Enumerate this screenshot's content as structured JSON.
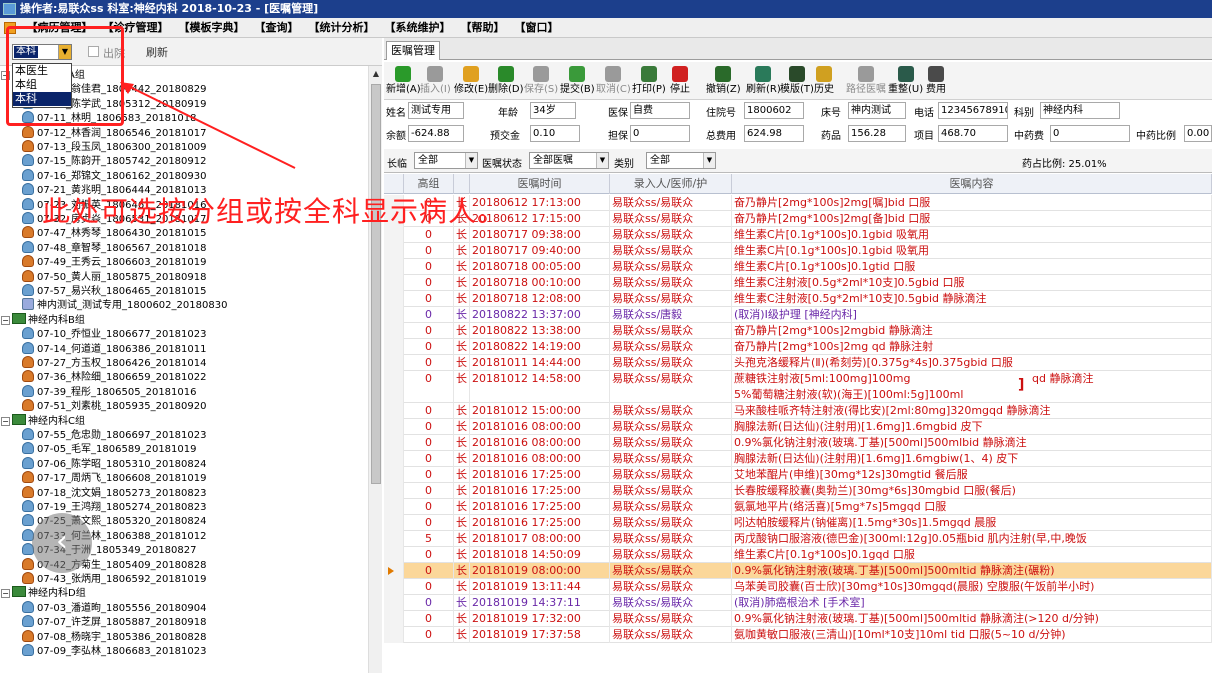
{
  "titlebar": {
    "text": "操作者:易联众ss  科室:神经内科  2018-10-23 - [医嘱管理]"
  },
  "menu": [
    "【病历管理】",
    "【诊疗管理】",
    "【模板字典】",
    "【查询】",
    "【统计分析】",
    "【系统维护】",
    "【帮助】",
    "【窗口】"
  ],
  "left": {
    "combo_value": "本科",
    "checkbox_label": "出院",
    "refresh_label": "刷新",
    "dropdown_options": [
      "本医生",
      "本组",
      "本科"
    ],
    "tree": [
      {
        "kind": "group",
        "label": "神经内科A组"
      },
      {
        "kind": "male",
        "label": "07-01_翁佳君_1805442_20180829"
      },
      {
        "kind": "male",
        "label": "07-02_陈学武_1805312_20180919"
      },
      {
        "kind": "male",
        "label": "07-11_林明_1806583_20181018"
      },
      {
        "kind": "female",
        "label": "07-12_林香润_1806546_20181017"
      },
      {
        "kind": "female",
        "label": "07-13_段玉凤_1806300_20181009"
      },
      {
        "kind": "male",
        "label": "07-15_陈韵开_1805742_20180912"
      },
      {
        "kind": "male",
        "label": "07-16_郑锦文_1806162_20180930"
      },
      {
        "kind": "male",
        "label": "07-21_黄兆明_1806444_20181013"
      },
      {
        "kind": "male",
        "label": "07-23_刘振英_1806461_20181016"
      },
      {
        "kind": "male",
        "label": "07-32_房贞焱_1806531_20181017"
      },
      {
        "kind": "female",
        "label": "07-47_林秀琴_1806430_20181015"
      },
      {
        "kind": "male",
        "label": "07-48_章智琴_1806567_20181018"
      },
      {
        "kind": "female",
        "label": "07-49_王秀云_1806603_20181019"
      },
      {
        "kind": "female",
        "label": "07-50_黄人丽_1805875_20180918"
      },
      {
        "kind": "male",
        "label": "07-57_易兴秋_1806465_20181015"
      },
      {
        "kind": "test",
        "label": "神内测试_测试专用_1800602_20180830"
      },
      {
        "kind": "group",
        "label": "神经内科B组"
      },
      {
        "kind": "male",
        "label": "07-10_乔恒业_1806677_20181023"
      },
      {
        "kind": "male",
        "label": "07-14_何道道_1806386_20181011"
      },
      {
        "kind": "female",
        "label": "07-27_方玉权_1806426_20181014"
      },
      {
        "kind": "female",
        "label": "07-36_林险细_1806659_20181022"
      },
      {
        "kind": "male",
        "label": "07-39_程彤_1806505_20181016"
      },
      {
        "kind": "female",
        "label": "07-51_刘素桃_1805935_20180920"
      },
      {
        "kind": "group",
        "label": "神经内科C组"
      },
      {
        "kind": "male",
        "label": "07-55_危忠勋_1806697_20181023"
      },
      {
        "kind": "male",
        "label": "07-05_毛军_1806589_20181019"
      },
      {
        "kind": "male",
        "label": "07-06_陈学昭_1805310_20180824"
      },
      {
        "kind": "female",
        "label": "07-17_周炳飞_1806608_20181019"
      },
      {
        "kind": "female",
        "label": "07-18_沈文娟_1805273_20180823"
      },
      {
        "kind": "male",
        "label": "07-19_王鸿翔_1805274_20180823"
      },
      {
        "kind": "male",
        "label": "07-25_萧文熙_1805320_20180824"
      },
      {
        "kind": "male",
        "label": "07-33_何兰林_1806388_20181012"
      },
      {
        "kind": "male",
        "label": "07-34_于洲_1805349_20180827"
      },
      {
        "kind": "female",
        "label": "07-42_方菊生_1805409_20180828"
      },
      {
        "kind": "female",
        "label": "07-43_张炳用_1806592_20181019"
      },
      {
        "kind": "group",
        "label": "神经内科D组"
      },
      {
        "kind": "male",
        "label": "07-03_潘道昫_1805556_20180904"
      },
      {
        "kind": "male",
        "label": "07-07_许芝屏_1805887_20180918"
      },
      {
        "kind": "female",
        "label": "07-08_杨晓宇_1805386_20180828"
      },
      {
        "kind": "male",
        "label": "07-09_李弘林_1806683_20181023"
      }
    ]
  },
  "annotation": "此处可选按分组或按全科显示病人。",
  "right": {
    "tab_label": "医嘱管理",
    "toolbar": [
      {
        "label": "新增(A)",
        "icon": "add-icon",
        "color": "#2a9a2a",
        "enabled": true
      },
      {
        "label": "插入(I)",
        "icon": "insert-icon",
        "color": "#9a9a9a",
        "enabled": false
      },
      {
        "label": "修改(E)",
        "icon": "edit-icon",
        "color": "#e0a020",
        "enabled": true
      },
      {
        "label": "删除(D)",
        "icon": "delete-icon",
        "color": "#2a8a2a",
        "enabled": true
      },
      {
        "label": "保存(S)",
        "icon": "save-icon",
        "color": "#9a9a9a",
        "enabled": false
      },
      {
        "label": "提交(B)",
        "icon": "submit-icon",
        "color": "#3a9a3a",
        "enabled": true
      },
      {
        "label": "取消(C)",
        "icon": "undo-icon",
        "color": "#9a9a9a",
        "enabled": false
      },
      {
        "label": "打印(P)",
        "icon": "print-icon",
        "color": "#3a7a3a",
        "enabled": true
      },
      {
        "label": "停止",
        "icon": "stop-icon",
        "color": "#d02020",
        "enabled": true
      },
      {
        "label": "撤销(Z)",
        "icon": "revoke-icon",
        "color": "#2a6a2a",
        "enabled": true
      },
      {
        "label": "刷新(R)",
        "icon": "refresh-icon",
        "color": "#2a7a5a",
        "enabled": true
      },
      {
        "label": "模版(T)",
        "icon": "template-icon",
        "color": "#2a4a2a",
        "enabled": true
      },
      {
        "label": "历史",
        "icon": "history-icon",
        "color": "#d0a020",
        "enabled": true
      },
      {
        "label": "路径医嘱",
        "icon": "path-icon",
        "color": "#9a9a9a",
        "enabled": false
      },
      {
        "label": "重整(U)",
        "icon": "reorg-icon",
        "color": "#2a5a4a",
        "enabled": true
      },
      {
        "label": "费用",
        "icon": "fee-icon",
        "color": "#4a4a4a",
        "enabled": true
      }
    ],
    "patient": {
      "name_label": "姓名",
      "name": "测试专用",
      "age_label": "年龄",
      "age": "34岁",
      "ins_label": "医保",
      "ins": "自费",
      "admit_label": "住院号",
      "admit": "1800602",
      "bed_label": "床号",
      "bed": "神内测试",
      "phone_label": "电话",
      "phone": "12345678910",
      "dept_label": "科别",
      "dept": "神经内科",
      "balance_label": "余额",
      "balance": "-624.88",
      "deposit_label": "预交金",
      "deposit": "0.10",
      "guarantee_label": "担保",
      "guarantee": "0",
      "total_label": "总费用",
      "total": "624.98",
      "drug_label": "药品",
      "drug": "156.28",
      "item_label": "项目",
      "item": "468.70",
      "tcm_label": "中药费",
      "tcm": "0",
      "tcm_ratio_label": "中药比例",
      "tcm_ratio": "0.00"
    },
    "filter": {
      "term_label": "长临",
      "term_value": "全部",
      "status_label": "医嘱状态",
      "status_value": "全部医嘱",
      "type_label": "类别",
      "type_value": "全部",
      "ratio": "药占比例: 25.01%"
    },
    "columns": [
      "",
      "高组",
      "",
      "医嘱时间",
      "录入人/医师/护",
      "医嘱内容"
    ],
    "rows": [
      {
        "n": "0",
        "t": "长",
        "time": "20180612 17:13:00",
        "who": "易联众ss/易联众",
        "content": "奋乃静片[2mg*100s]2mg[嘱]bid 口服",
        "style": "red"
      },
      {
        "n": "0",
        "t": "长",
        "time": "20180612 17:15:00",
        "who": "易联众ss/易联众",
        "content": "奋乃静片[2mg*100s]2mg[备]bid 口服",
        "style": "red"
      },
      {
        "n": "0",
        "t": "长",
        "time": "20180717 09:38:00",
        "who": "易联众ss/易联众",
        "content": "维生素C片[0.1g*100s]0.1gbid 吸氧用",
        "style": "red"
      },
      {
        "n": "0",
        "t": "长",
        "time": "20180717 09:40:00",
        "who": "易联众ss/易联众",
        "content": "维生素C片[0.1g*100s]0.1gbid 吸氧用",
        "style": "red"
      },
      {
        "n": "0",
        "t": "长",
        "time": "20180718 00:05:00",
        "who": "易联众ss/易联众",
        "content": "维生素C片[0.1g*100s]0.1gtid 口服",
        "style": "red"
      },
      {
        "n": "0",
        "t": "长",
        "time": "20180718 00:10:00",
        "who": "易联众ss/易联众",
        "content": "维生素C注射液[0.5g*2ml*10支]0.5gbid 口服",
        "style": "red"
      },
      {
        "n": "0",
        "t": "长",
        "time": "20180718 12:08:00",
        "who": "易联众ss/易联众",
        "content": "维生素C注射液[0.5g*2ml*10支]0.5gbid 静脉滴注",
        "style": "red"
      },
      {
        "n": "0",
        "t": "长",
        "time": "20180822 13:37:00",
        "who": "易联众ss/唐毅",
        "content": "(取消)Ⅰ级护理   [神经内科]",
        "style": "cancel"
      },
      {
        "n": "0",
        "t": "长",
        "time": "20180822 13:38:00",
        "who": "易联众ss/易联众",
        "content": "奋乃静片[2mg*100s]2mgbid 静脉滴注",
        "style": "red"
      },
      {
        "n": "0",
        "t": "长",
        "time": "20180822 14:19:00",
        "who": "易联众ss/易联众",
        "content": "奋乃静片[2mg*100s]2mg qd 静脉注射",
        "style": "red"
      },
      {
        "n": "0",
        "t": "长",
        "time": "20181011 14:44:00",
        "who": "易联众ss/易联众",
        "content": "头孢克洛缓释片(Ⅱ)(希刻劳)[0.375g*4s]0.375gbid 口服",
        "style": "red"
      },
      {
        "n": "0",
        "t": "长",
        "time": "20181012 14:58:00",
        "who": "易联众ss/易联众",
        "content": "蔗糖铁注射液[5ml:100mg]100mg",
        "content2": "5%葡萄糖注射液(软)(海王)[100ml:5g]100ml",
        "right": "qd 静脉滴注",
        "style": "red",
        "tall": true
      },
      {
        "n": "0",
        "t": "长",
        "time": "20181012 15:00:00",
        "who": "易联众ss/易联众",
        "content": "马来酸桂哌齐特注射液(得比安)[2ml:80mg]320mgqd 静脉滴注",
        "style": "red"
      },
      {
        "n": "0",
        "t": "长",
        "time": "20181016 08:00:00",
        "who": "易联众ss/易联众",
        "content": "胸腺法新(日达仙)(注射用)[1.6mg]1.6mgbid 皮下",
        "style": "red"
      },
      {
        "n": "0",
        "t": "长",
        "time": "20181016 08:00:00",
        "who": "易联众ss/易联众",
        "content": "0.9%氯化钠注射液(玻璃.丁基)[500ml]500mlbid 静脉滴注",
        "style": "red"
      },
      {
        "n": "0",
        "t": "长",
        "time": "20181016 08:00:00",
        "who": "易联众ss/易联众",
        "content": "胸腺法新(日达仙)(注射用)[1.6mg]1.6mgbiw(1、4) 皮下",
        "style": "red"
      },
      {
        "n": "0",
        "t": "长",
        "time": "20181016 17:25:00",
        "who": "易联众ss/易联众",
        "content": "艾地苯醌片(申维)[30mg*12s]30mgtid 餐后服",
        "style": "red"
      },
      {
        "n": "0",
        "t": "长",
        "time": "20181016 17:25:00",
        "who": "易联众ss/易联众",
        "content": "长春胺缓释胶囊(奥勃兰)[30mg*6s]30mgbid 口服(餐后)",
        "style": "red"
      },
      {
        "n": "0",
        "t": "长",
        "time": "20181016 17:25:00",
        "who": "易联众ss/易联众",
        "content": "氨氯地平片(络活喜)[5mg*7s]5mgqd 口服",
        "style": "red"
      },
      {
        "n": "0",
        "t": "长",
        "time": "20181016 17:25:00",
        "who": "易联众ss/易联众",
        "content": "吲达帕胺缓释片(钠催离)[1.5mg*30s]1.5mgqd 晨服",
        "style": "red"
      },
      {
        "n": "5",
        "t": "长",
        "time": "20181017 08:00:00",
        "who": "易联众ss/易联众",
        "content": "丙戊酸钠口服溶液(德巴金)[300ml:12g]0.05瓶bid 肌内注射(早,中,晚饭",
        "style": "red"
      },
      {
        "n": "0",
        "t": "长",
        "time": "20181018 14:50:09",
        "who": "易联众ss/易联众",
        "content": "维生素C片[0.1g*100s]0.1gqd 口服",
        "style": "red"
      },
      {
        "n": "0",
        "t": "长",
        "time": "20181019 08:00:00",
        "who": "易联众ss/易联众",
        "content": "0.9%氯化钠注射液(玻璃.丁基)[500ml]500mltid 静脉滴注(碾粉)",
        "style": "sel"
      },
      {
        "n": "0",
        "t": "长",
        "time": "20181019 13:11:44",
        "who": "易联众ss/易联众",
        "content": "乌苯美司胶囊(百士欣)[30mg*10s]30mgqd(晨服) 空腹服(午饭前半小时)",
        "style": "red"
      },
      {
        "n": "0",
        "t": "长",
        "time": "20181019 14:37:11",
        "who": "易联众ss/易联众",
        "content": "(取消)肺癌根治术   [手术室]",
        "style": "cancel"
      },
      {
        "n": "0",
        "t": "长",
        "time": "20181019 17:32:00",
        "who": "易联众ss/易联众",
        "content": "0.9%氯化钠注射液(玻璃.丁基)[500ml]500mltid 静脉滴注(>120 d/分钟)",
        "style": "red"
      },
      {
        "n": "0",
        "t": "长",
        "time": "20181019 17:37:58",
        "who": "易联众ss/易联众",
        "content": "氨咖黄敏口服液(三清山)[10ml*10支]10ml tid 口服(5~10 d/分钟)",
        "style": "red"
      }
    ]
  }
}
